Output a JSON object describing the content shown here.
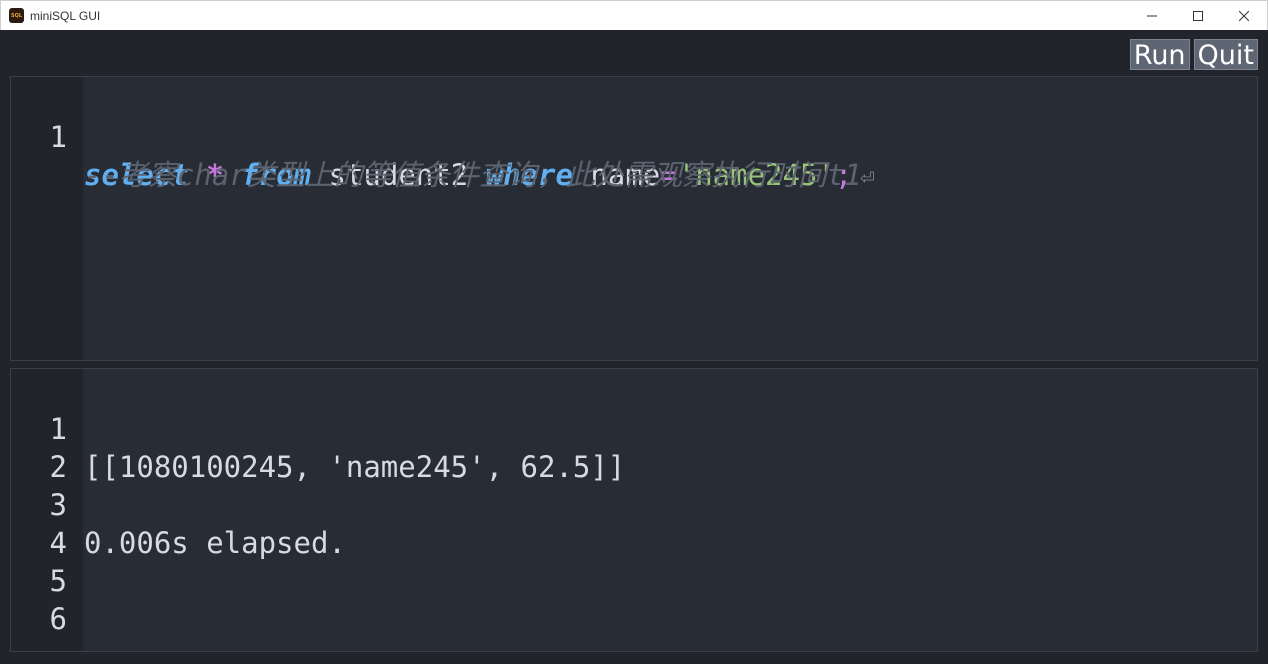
{
  "window": {
    "title": "miniSQL GUI",
    "icon_text": "SQL",
    "minimize": "—",
    "maximize": "☐",
    "close": "✕"
  },
  "toolbar": {
    "run_label": "Run",
    "quit_label": "Quit"
  },
  "editor": {
    "line_numbers": [
      "1"
    ],
    "line1": {
      "select": "select",
      "star": "*",
      "from": "from",
      "table": "student2",
      "where": "where",
      "col": "name",
      "eq": "=",
      "value": "'name245'",
      "semi": ";",
      "eol": "⏎"
    },
    "line2_comment": "--考察char类型上的等值条件查询，此处需观察执行时间t1"
  },
  "output": {
    "lines": [
      {
        "n": "1",
        "text": "[[1080100245, 'name245', 62.5]]"
      },
      {
        "n": "2",
        "text": ""
      },
      {
        "n": "3",
        "text": "0.006s elapsed."
      },
      {
        "n": "4",
        "text": ""
      },
      {
        "n": "5",
        "text": ""
      },
      {
        "n": "6",
        "text": ""
      }
    ]
  },
  "colors": {
    "background": "#21252b",
    "pane": "#282c34",
    "keyword": "#61afef",
    "operator": "#c678dd",
    "string": "#98c379",
    "comment": "#5c6370",
    "text": "#d7dae0",
    "button": "#5d6672"
  }
}
